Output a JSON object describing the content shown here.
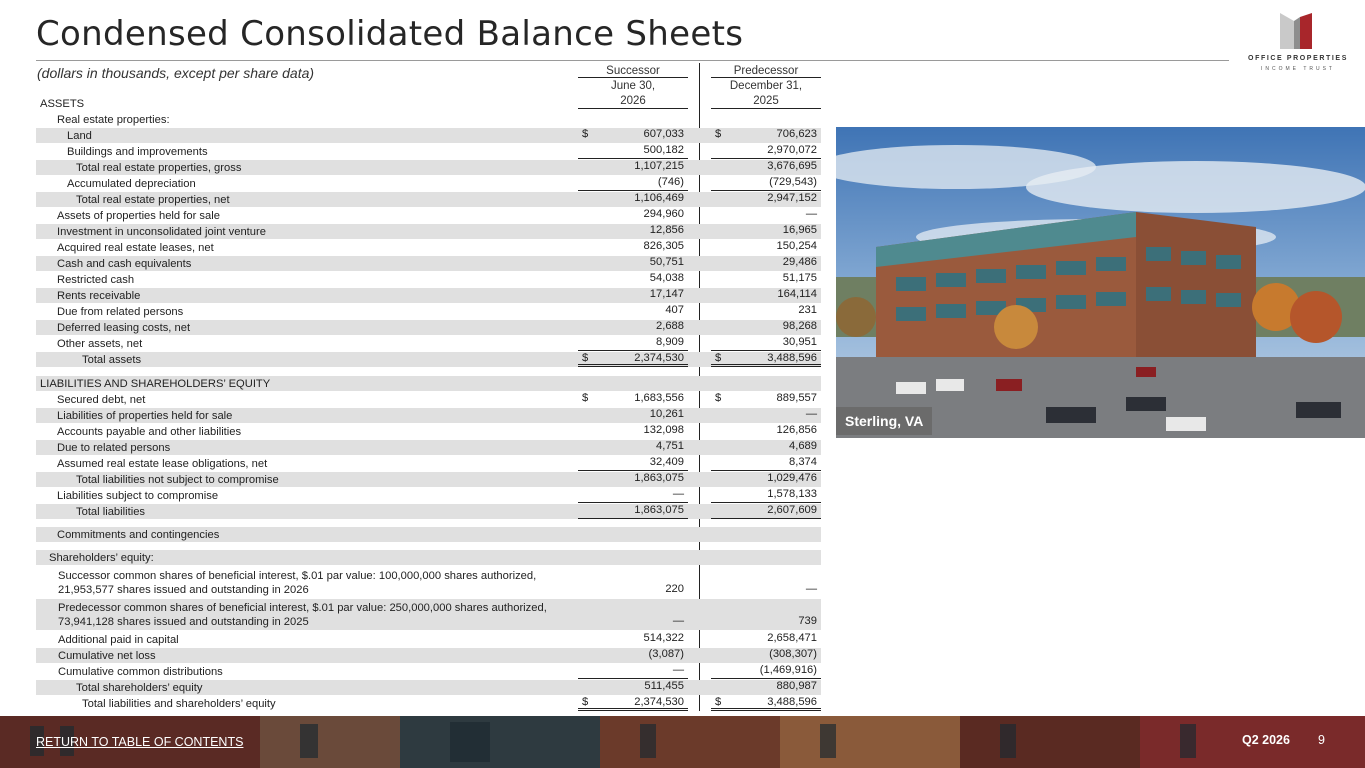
{
  "header": {
    "title": "Condensed Consolidated Balance Sheets",
    "subtitle": "(dollars in thousands, except per share data)",
    "logo_name": "OFFICE PROPERTIES",
    "logo_sub": "INCOME TRUST"
  },
  "columns": {
    "successor": "Successor",
    "predecessor": "Predecessor",
    "successor_date_1": "June 30,",
    "successor_date_2": "2026",
    "predecessor_date_1": "December 31,",
    "predecessor_date_2": "2025"
  },
  "rows": [
    {
      "label": "ASSETS",
      "v1": "",
      "v2": ""
    },
    {
      "label": "Real estate properties:",
      "v1": "",
      "v2": ""
    },
    {
      "label": "Land",
      "d1": "$",
      "v1": "607,033",
      "d2": "$",
      "v2": "706,623"
    },
    {
      "label": "Buildings and improvements",
      "v1": "500,182",
      "v2": "2,970,072"
    },
    {
      "label": "Total real estate properties, gross",
      "v1": "1,107,215",
      "v2": "3,676,695"
    },
    {
      "label": "Accumulated depreciation",
      "v1": "(746)",
      "v2": "(729,543)"
    },
    {
      "label": "Total real estate properties, net",
      "v1": "1,106,469",
      "v2": "2,947,152"
    },
    {
      "label": "Assets of properties held for sale",
      "v1": "294,960",
      "v2": "—"
    },
    {
      "label": "Investment in unconsolidated joint venture",
      "v1": "12,856",
      "v2": "16,965"
    },
    {
      "label": "Acquired real estate leases, net",
      "v1": "826,305",
      "v2": "150,254"
    },
    {
      "label": "Cash and cash equivalents",
      "v1": "50,751",
      "v2": "29,486"
    },
    {
      "label": "Restricted cash",
      "v1": "54,038",
      "v2": "51,175"
    },
    {
      "label": "Rents receivable",
      "v1": "17,147",
      "v2": "164,114"
    },
    {
      "label": "Due from related persons",
      "v1": "407",
      "v2": "231"
    },
    {
      "label": "Deferred leasing costs, net",
      "v1": "2,688",
      "v2": "98,268"
    },
    {
      "label": "Other assets, net",
      "v1": "8,909",
      "v2": "30,951"
    },
    {
      "label": "Total assets",
      "d1": "$",
      "v1": "2,374,530",
      "d2": "$",
      "v2": "3,488,596"
    },
    {
      "label": "LIABILITIES AND SHAREHOLDERS’ EQUITY",
      "v1": "",
      "v2": ""
    },
    {
      "label": "Secured debt, net",
      "d1": "$",
      "v1": "1,683,556",
      "d2": "$",
      "v2": "889,557"
    },
    {
      "label": "Liabilities of properties held for sale",
      "v1": "10,261",
      "v2": "—"
    },
    {
      "label": "Accounts payable and other liabilities",
      "v1": "132,098",
      "v2": "126,856"
    },
    {
      "label": "Due to related persons",
      "v1": "4,751",
      "v2": "4,689"
    },
    {
      "label": "Assumed real estate lease obligations, net",
      "v1": "32,409",
      "v2": "8,374"
    },
    {
      "label": "Total liabilities not subject to compromise",
      "v1": "1,863,075",
      "v2": "1,029,476"
    },
    {
      "label": "Liabilities subject to compromise",
      "v1": "—",
      "v2": "1,578,133"
    },
    {
      "label": "Total liabilities",
      "v1": "1,863,075",
      "v2": "2,607,609"
    },
    {
      "label": "Commitments and contingencies",
      "v1": "",
      "v2": ""
    },
    {
      "label": "Shareholders’ equity:",
      "v1": "",
      "v2": ""
    },
    {
      "label": "Successor common shares of beneficial interest, $.01 par value: 100,000,000 shares authorized, 21,953,577 shares issued and outstanding in 2026",
      "v1": "220",
      "v2": "—"
    },
    {
      "label": "Predecessor common shares of beneficial interest, $.01 par value: 250,000,000 shares authorized, 73,941,128 shares issued and outstanding in 2025",
      "v1": "—",
      "v2": "739"
    },
    {
      "label": "Additional paid in capital",
      "v1": "514,322",
      "v2": "2,658,471"
    },
    {
      "label": "Cumulative net loss",
      "v1": "(3,087)",
      "v2": "(308,307)"
    },
    {
      "label": "Cumulative common distributions",
      "v1": "—",
      "v2": "(1,469,916)"
    },
    {
      "label": "Total shareholders’ equity",
      "v1": "511,455",
      "v2": "880,987"
    },
    {
      "label": "Total liabilities and shareholders’ equity",
      "d1": "$",
      "v1": "2,374,530",
      "d2": "$",
      "v2": "3,488,596"
    }
  ],
  "photo": {
    "caption": "Sterling, VA"
  },
  "footer": {
    "link": "RETURN TO TABLE OF CONTENTS",
    "quarter": "Q2 2026",
    "page": "9"
  },
  "colors": {
    "accent": "#a8262b",
    "shade": "#e0e0e0"
  }
}
